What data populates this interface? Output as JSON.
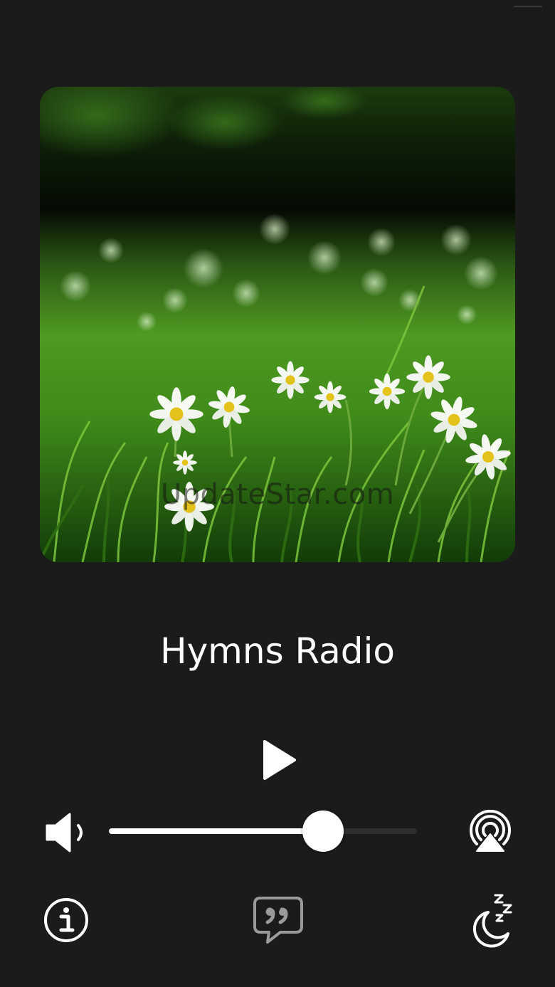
{
  "artwork": {
    "watermark_text": "UpdateStar.com",
    "description_icon": "daisy-meadow-artwork"
  },
  "player": {
    "station_title": "Hymns Radio",
    "state": "paused"
  },
  "volume": {
    "level": 0.695
  },
  "icons": {
    "play": "play-icon",
    "volume": "speaker-icon",
    "airplay": "airplay-icon",
    "info": "info-icon",
    "quote": "quote-bubble-icon",
    "sleep": "sleep-timer-icon"
  },
  "colors": {
    "background": "#1b1b1c",
    "foreground": "#ffffff",
    "track": "#2e2e30",
    "quote_icon": "#9a9a9c"
  }
}
